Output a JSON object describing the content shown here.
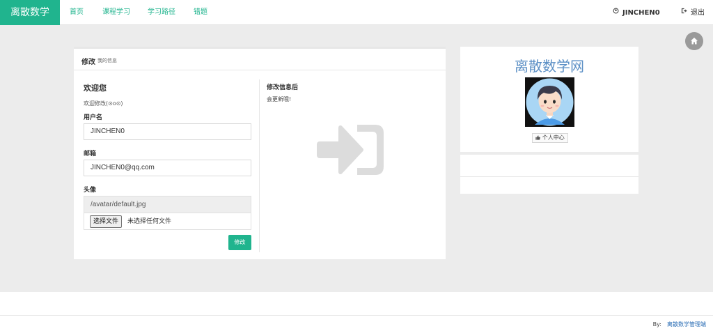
{
  "navbar": {
    "brand": "离散数学",
    "items": [
      {
        "label": "首页"
      },
      {
        "label": "课程学习"
      },
      {
        "label": "学习路径"
      },
      {
        "label": "错题"
      }
    ],
    "user": "JINCHEN0",
    "logout": "退出",
    "accent_color": "#20b48e"
  },
  "profile_panel": {
    "title": "修改",
    "subtitle": "我的信息",
    "welcome": "欢迎您",
    "welcome_sub": "欢迎修改(⊙o⊙)",
    "username_label": "用户名",
    "username_value": "JINCHEN0",
    "email_label": "邮箱",
    "email_value": "JINCHEN0@qq.com",
    "avatar_label": "头像",
    "avatar_path": "/avatar/default.jpg",
    "file_button": "选择文件",
    "file_status": "未选择任何文件",
    "submit": "修改",
    "info_title": "修改信息后",
    "info_sub": "会更新哦!"
  },
  "side_panel": {
    "site_title": "离散数学网",
    "center_button": "个人中心"
  },
  "footer": {
    "by_label": "By:",
    "link": "离散数学管理端"
  }
}
